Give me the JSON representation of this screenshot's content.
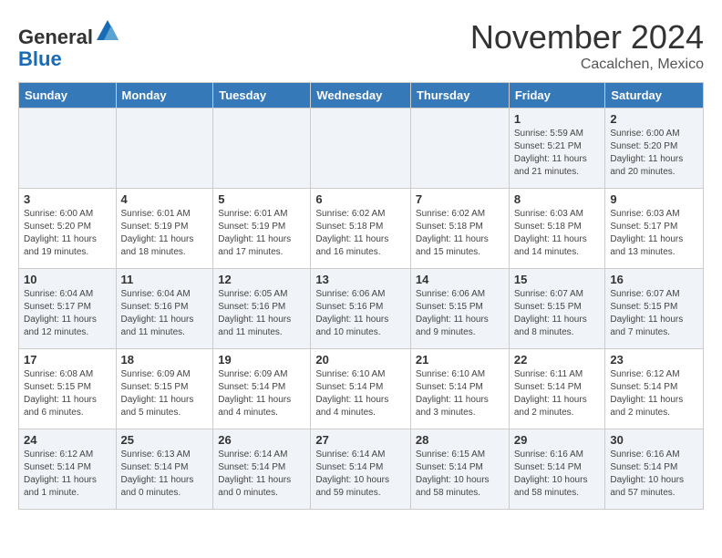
{
  "header": {
    "logo_line1": "General",
    "logo_line2": "Blue",
    "month": "November 2024",
    "location": "Cacalchen, Mexico"
  },
  "weekdays": [
    "Sunday",
    "Monday",
    "Tuesday",
    "Wednesday",
    "Thursday",
    "Friday",
    "Saturday"
  ],
  "weeks": [
    [
      {
        "day": "",
        "info": ""
      },
      {
        "day": "",
        "info": ""
      },
      {
        "day": "",
        "info": ""
      },
      {
        "day": "",
        "info": ""
      },
      {
        "day": "",
        "info": ""
      },
      {
        "day": "1",
        "info": "Sunrise: 5:59 AM\nSunset: 5:21 PM\nDaylight: 11 hours and 21 minutes."
      },
      {
        "day": "2",
        "info": "Sunrise: 6:00 AM\nSunset: 5:20 PM\nDaylight: 11 hours and 20 minutes."
      }
    ],
    [
      {
        "day": "3",
        "info": "Sunrise: 6:00 AM\nSunset: 5:20 PM\nDaylight: 11 hours and 19 minutes."
      },
      {
        "day": "4",
        "info": "Sunrise: 6:01 AM\nSunset: 5:19 PM\nDaylight: 11 hours and 18 minutes."
      },
      {
        "day": "5",
        "info": "Sunrise: 6:01 AM\nSunset: 5:19 PM\nDaylight: 11 hours and 17 minutes."
      },
      {
        "day": "6",
        "info": "Sunrise: 6:02 AM\nSunset: 5:18 PM\nDaylight: 11 hours and 16 minutes."
      },
      {
        "day": "7",
        "info": "Sunrise: 6:02 AM\nSunset: 5:18 PM\nDaylight: 11 hours and 15 minutes."
      },
      {
        "day": "8",
        "info": "Sunrise: 6:03 AM\nSunset: 5:18 PM\nDaylight: 11 hours and 14 minutes."
      },
      {
        "day": "9",
        "info": "Sunrise: 6:03 AM\nSunset: 5:17 PM\nDaylight: 11 hours and 13 minutes."
      }
    ],
    [
      {
        "day": "10",
        "info": "Sunrise: 6:04 AM\nSunset: 5:17 PM\nDaylight: 11 hours and 12 minutes."
      },
      {
        "day": "11",
        "info": "Sunrise: 6:04 AM\nSunset: 5:16 PM\nDaylight: 11 hours and 11 minutes."
      },
      {
        "day": "12",
        "info": "Sunrise: 6:05 AM\nSunset: 5:16 PM\nDaylight: 11 hours and 11 minutes."
      },
      {
        "day": "13",
        "info": "Sunrise: 6:06 AM\nSunset: 5:16 PM\nDaylight: 11 hours and 10 minutes."
      },
      {
        "day": "14",
        "info": "Sunrise: 6:06 AM\nSunset: 5:15 PM\nDaylight: 11 hours and 9 minutes."
      },
      {
        "day": "15",
        "info": "Sunrise: 6:07 AM\nSunset: 5:15 PM\nDaylight: 11 hours and 8 minutes."
      },
      {
        "day": "16",
        "info": "Sunrise: 6:07 AM\nSunset: 5:15 PM\nDaylight: 11 hours and 7 minutes."
      }
    ],
    [
      {
        "day": "17",
        "info": "Sunrise: 6:08 AM\nSunset: 5:15 PM\nDaylight: 11 hours and 6 minutes."
      },
      {
        "day": "18",
        "info": "Sunrise: 6:09 AM\nSunset: 5:15 PM\nDaylight: 11 hours and 5 minutes."
      },
      {
        "day": "19",
        "info": "Sunrise: 6:09 AM\nSunset: 5:14 PM\nDaylight: 11 hours and 4 minutes."
      },
      {
        "day": "20",
        "info": "Sunrise: 6:10 AM\nSunset: 5:14 PM\nDaylight: 11 hours and 4 minutes."
      },
      {
        "day": "21",
        "info": "Sunrise: 6:10 AM\nSunset: 5:14 PM\nDaylight: 11 hours and 3 minutes."
      },
      {
        "day": "22",
        "info": "Sunrise: 6:11 AM\nSunset: 5:14 PM\nDaylight: 11 hours and 2 minutes."
      },
      {
        "day": "23",
        "info": "Sunrise: 6:12 AM\nSunset: 5:14 PM\nDaylight: 11 hours and 2 minutes."
      }
    ],
    [
      {
        "day": "24",
        "info": "Sunrise: 6:12 AM\nSunset: 5:14 PM\nDaylight: 11 hours and 1 minute."
      },
      {
        "day": "25",
        "info": "Sunrise: 6:13 AM\nSunset: 5:14 PM\nDaylight: 11 hours and 0 minutes."
      },
      {
        "day": "26",
        "info": "Sunrise: 6:14 AM\nSunset: 5:14 PM\nDaylight: 11 hours and 0 minutes."
      },
      {
        "day": "27",
        "info": "Sunrise: 6:14 AM\nSunset: 5:14 PM\nDaylight: 10 hours and 59 minutes."
      },
      {
        "day": "28",
        "info": "Sunrise: 6:15 AM\nSunset: 5:14 PM\nDaylight: 10 hours and 58 minutes."
      },
      {
        "day": "29",
        "info": "Sunrise: 6:16 AM\nSunset: 5:14 PM\nDaylight: 10 hours and 58 minutes."
      },
      {
        "day": "30",
        "info": "Sunrise: 6:16 AM\nSunset: 5:14 PM\nDaylight: 10 hours and 57 minutes."
      }
    ]
  ]
}
